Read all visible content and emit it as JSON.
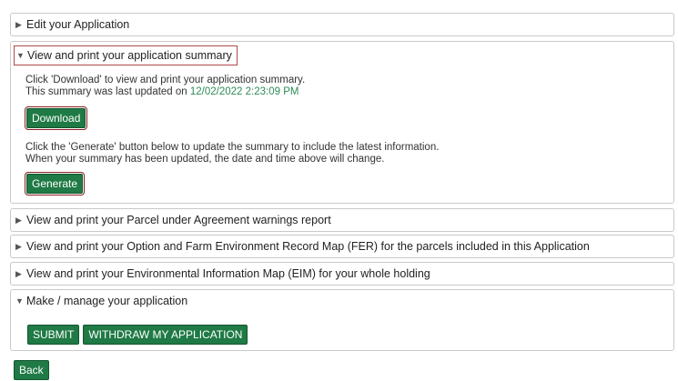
{
  "panels": {
    "edit": {
      "label": "Edit your Application"
    },
    "summary": {
      "label": "View and print your application summary",
      "download_text": "Click 'Download' to view and print your application summary.",
      "updated_prefix": "This summary was last updated on ",
      "updated_date": "12/02/2022 2:23:09 PM",
      "download_button": "Download",
      "generate_text_1": "Click the 'Generate' button below to update the summary to include the latest information.",
      "generate_text_2": "When your summary has been updated, the date and time above will change.",
      "generate_button": "Generate"
    },
    "parcel": {
      "label": "View and print your Parcel under Agreement warnings report"
    },
    "option_fer": {
      "label": "View and print your Option and Farm Environment Record Map (FER) for the parcels included in this Application"
    },
    "eim": {
      "label": "View and print your Environmental Information Map (EIM) for your whole holding"
    },
    "manage": {
      "label": "Make / manage your application",
      "submit_button": "SUBMIT",
      "withdraw_button": "WITHDRAW MY APPLICATION"
    }
  },
  "back_button": "Back",
  "colors": {
    "button_green": "#1f7a45",
    "date_green": "#2e8b57",
    "highlight_red": "#b24a4a"
  },
  "icons": {
    "collapsed": "triangle-right-icon",
    "expanded": "triangle-down-icon"
  }
}
